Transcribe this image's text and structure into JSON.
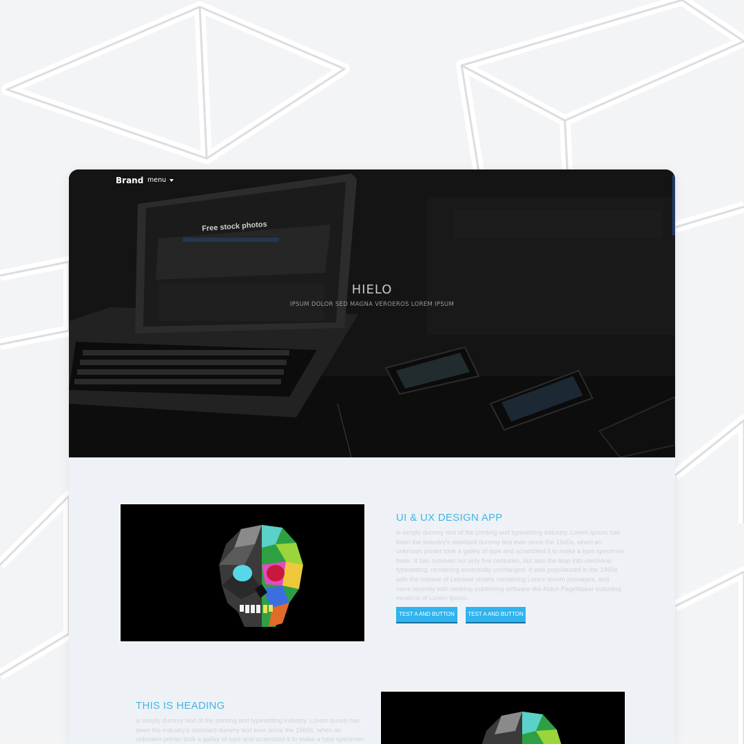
{
  "navbar": {
    "brand": "Brand",
    "menu_label": "menu"
  },
  "hero": {
    "title": "HIELO",
    "subtitle": "IPSUM DOLOR SED MAGNA VEROEROS LOREM IPSUM",
    "screen_heading": "Free stock photos"
  },
  "sections": [
    {
      "title": "UI & UX DESIGN APP",
      "text": "is simply dummy text of the printing and typesetting industry. Lorem Ipsum has been the industry's standard dummy text ever since the 1500s, when an unknown printer took a galley of type and scrambled it to make a type specimen book. It has survived not only five centuries, but also the leap into electronic typesetting, remaining essentially unchanged. It was popularised in the 1960s with the release of Letraset sheets containing Lorem Ipsum passages, and more recently with desktop publishing software like Aldus PageMaker including versions of Lorem Ipsum.",
      "buttons": [
        "TEST A AND BUTTON",
        "TEST A AND BUTTON"
      ]
    },
    {
      "title": "THIS IS HEADING",
      "text": "is simply dummy text of the printing and typesetting industry. Lorem Ipsum has been the industry's standard dummy text ever since the 1500s, when an unknown printer took a galley of type and scrambled it to make a type specimen"
    }
  ],
  "colors": {
    "accent": "#3fb5e6",
    "button": "#2fb4ef",
    "hero_overlay": "#161616",
    "section_bg": "#eef2f6"
  }
}
